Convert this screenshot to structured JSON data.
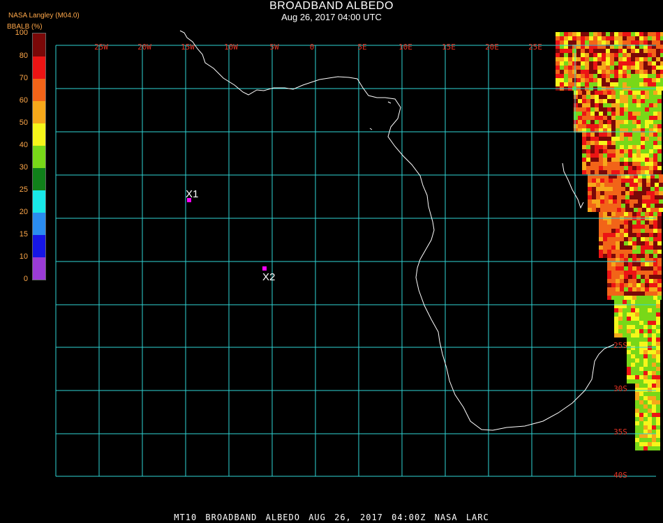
{
  "header": {
    "title": "BROADBAND ALBEDO",
    "subtitle": "Aug 26, 2017 04:00 UTC",
    "source": "NASA Langley (M04.0)"
  },
  "colorbar": {
    "title": "BBALB (%)",
    "segments": [
      {
        "from": 0,
        "to": 10,
        "color": "#9b3bd6"
      },
      {
        "from": 10,
        "to": 15,
        "color": "#1616e6"
      },
      {
        "from": 15,
        "to": 20,
        "color": "#2a8cf0"
      },
      {
        "from": 20,
        "to": 25,
        "color": "#18e8e8"
      },
      {
        "from": 25,
        "to": 30,
        "color": "#10801a"
      },
      {
        "from": 30,
        "to": 40,
        "color": "#78d818"
      },
      {
        "from": 40,
        "to": 50,
        "color": "#f6f61a"
      },
      {
        "from": 50,
        "to": 60,
        "color": "#f6a81a"
      },
      {
        "from": 60,
        "to": 70,
        "color": "#f26418"
      },
      {
        "from": 70,
        "to": 80,
        "color": "#ec1414"
      },
      {
        "from": 80,
        "to": 100,
        "color": "#7a0808"
      }
    ],
    "tick_labels": [
      "0",
      "10",
      "15",
      "20",
      "25",
      "30",
      "40",
      "50",
      "60",
      "70",
      "80",
      "100"
    ]
  },
  "map": {
    "grid_color": "#2fd6d6",
    "coast_color": "#ffffff",
    "longitude_labels": [
      "25W",
      "20W",
      "15W",
      "10W",
      "5W",
      "0",
      "5E",
      "10E",
      "15E",
      "20E",
      "25E"
    ],
    "latitude_labels": [
      "25S",
      "30S",
      "35S",
      "40S"
    ],
    "points": [
      {
        "label": "X1",
        "color": "#ff00ff"
      },
      {
        "label": "X2",
        "color": "#ff00ff"
      }
    ]
  },
  "footer": "MT10  BROADBAND ALBEDO   AUG 26, 2017 04:00Z   NASA LARC"
}
